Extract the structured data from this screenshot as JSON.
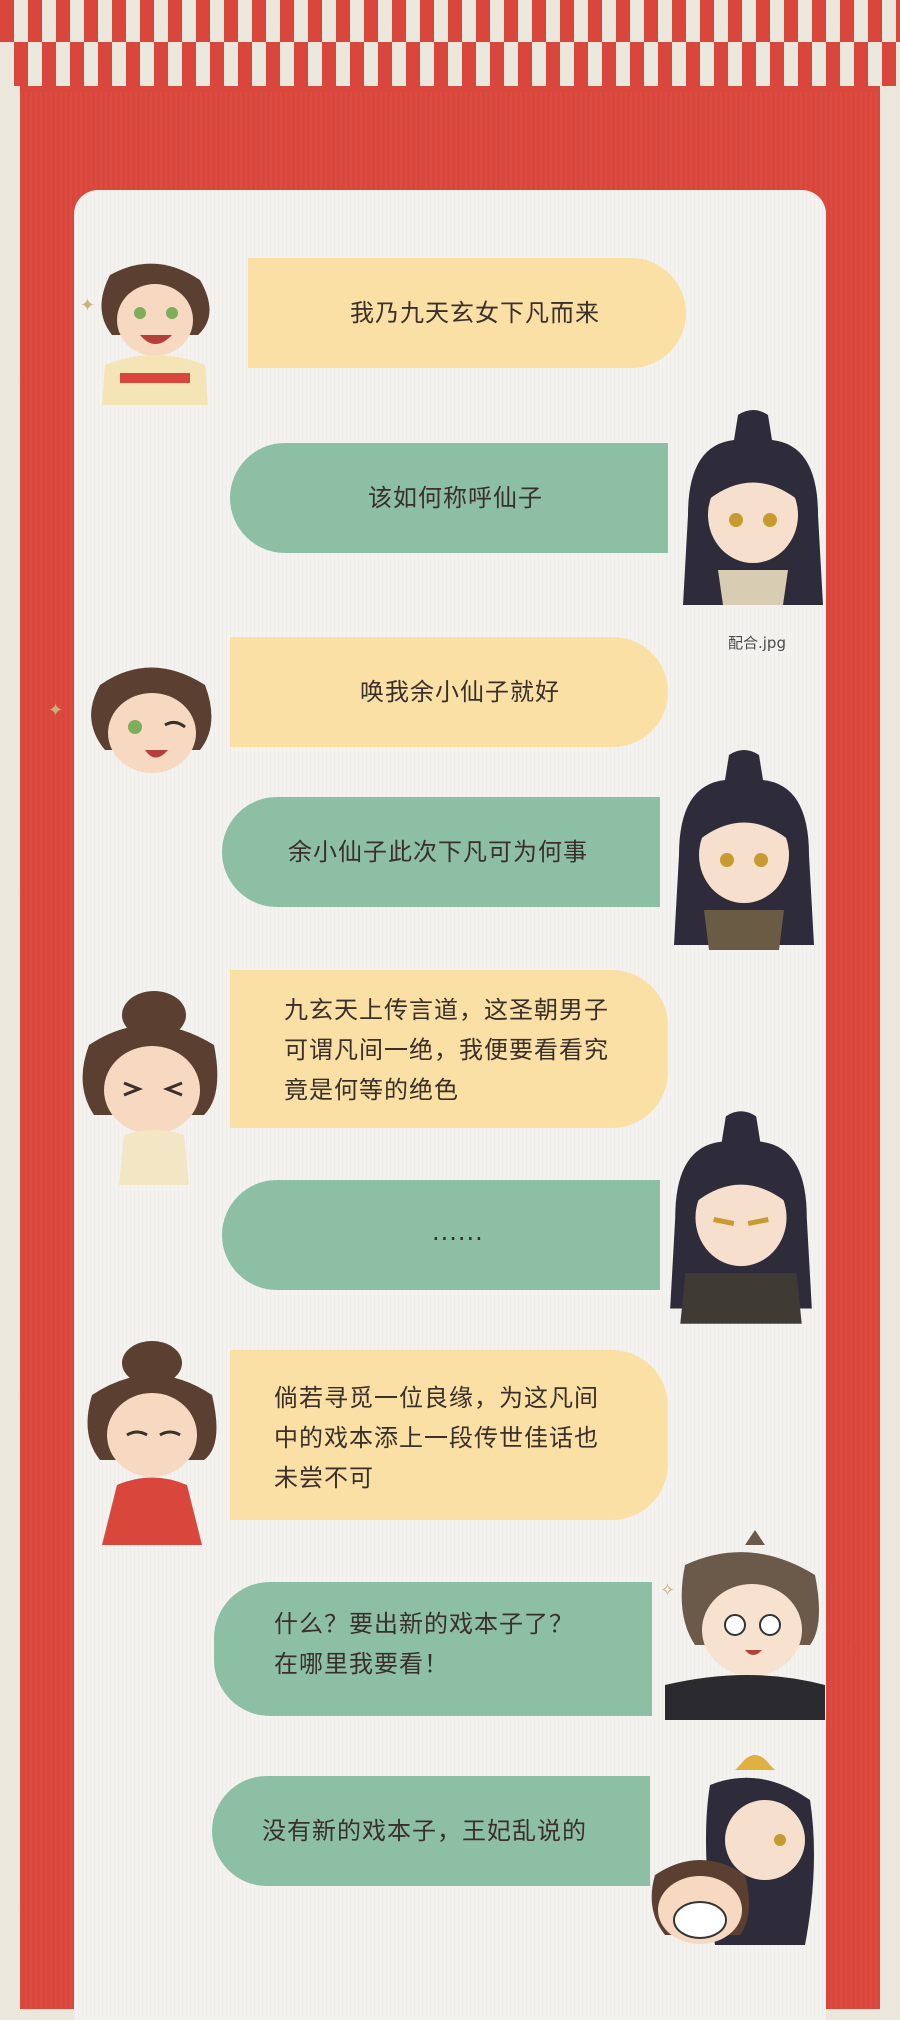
{
  "colors": {
    "frame_red": "#d9463b",
    "paper": "#f3f2ef",
    "bubble_yellow": "#fbe0a6",
    "bubble_green": "#8dbfa5"
  },
  "caption": "配合.jpg",
  "messages": [
    {
      "side": "left",
      "speaker": "girl",
      "text": "我乃九天玄女下凡而来"
    },
    {
      "side": "right",
      "speaker": "boy",
      "text": "该如何称呼仙子"
    },
    {
      "side": "left",
      "speaker": "girl",
      "text": "唤我余小仙子就好"
    },
    {
      "side": "right",
      "speaker": "boy",
      "text": "余小仙子此次下凡可为何事"
    },
    {
      "side": "left",
      "speaker": "girl",
      "text": "九玄天上传言道，这圣朝男子\n可谓凡间一绝，我便要看看究\n竟是何等的绝色"
    },
    {
      "side": "right",
      "speaker": "boy",
      "text": "......"
    },
    {
      "side": "left",
      "speaker": "girl",
      "text": "倘若寻觅一位良缘，为这凡间\n中的戏本添上一段传世佳话也\n未尝不可"
    },
    {
      "side": "right",
      "speaker": "friend",
      "text": "什么？要出新的戏本子了？\n在哪里我要看！"
    },
    {
      "side": "right",
      "speaker": "couple",
      "text": "没有新的戏本子，王妃乱说的"
    }
  ]
}
